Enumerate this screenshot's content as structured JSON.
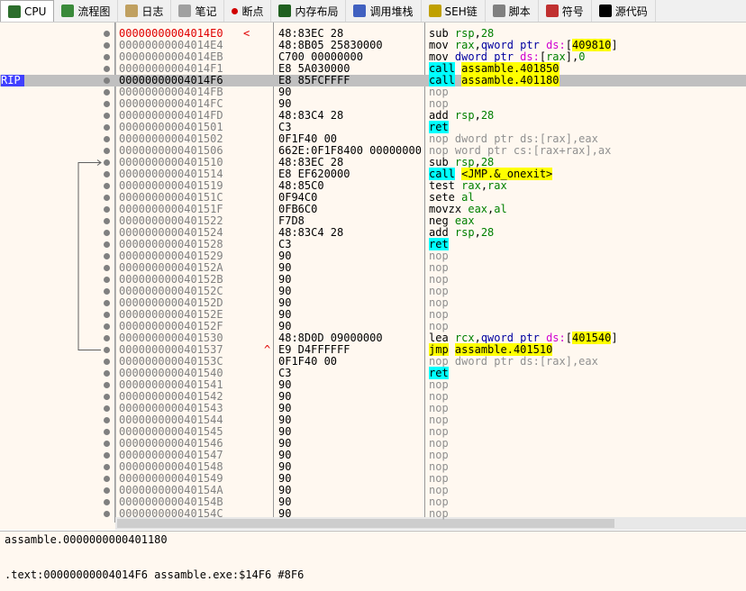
{
  "tabs": [
    {
      "label": "CPU",
      "icon": "cpu-icon",
      "color": "#2c6e2c",
      "active": true
    },
    {
      "label": "流程图",
      "icon": "tree-icon",
      "color": "#3a8a3a"
    },
    {
      "label": "日志",
      "icon": "log-icon",
      "color": "#c0a060"
    },
    {
      "label": "笔记",
      "icon": "notes-icon",
      "color": "#a0a0a0"
    },
    {
      "label": "断点",
      "icon": "breakpoint-icon",
      "color": "#d00000"
    },
    {
      "label": "内存布局",
      "icon": "memory-icon",
      "color": "#206020"
    },
    {
      "label": "调用堆栈",
      "icon": "callstack-icon",
      "color": "#4060c0"
    },
    {
      "label": "SEH链",
      "icon": "seh-icon",
      "color": "#c0a000"
    },
    {
      "label": "脚本",
      "icon": "script-icon",
      "color": "#808080"
    },
    {
      "label": "符号",
      "icon": "symbol-icon",
      "color": "#c03030"
    },
    {
      "label": "源代码",
      "icon": "source-icon",
      "color": "#000000"
    }
  ],
  "rip_label": "RIP",
  "rows": [
    {
      "a": "00000000004014E0",
      "m": "<",
      "b": "48:83EC 28",
      "d": [
        [
          "",
          "sub "
        ],
        [
          "r",
          "rsp"
        ],
        [
          "",
          ","
        ],
        [
          "n",
          "28"
        ]
      ],
      "cur": true
    },
    {
      "a": "00000000004014E4",
      "b": "48:8B05 25830000",
      "d": [
        [
          "",
          "mov "
        ],
        [
          "r",
          "rax"
        ],
        [
          "",
          ","
        ],
        [
          "k",
          "qword ptr "
        ],
        [
          "s",
          "ds:"
        ],
        [
          "",
          "["
        ],
        [
          "y",
          "409810"
        ],
        [
          "",
          "]"
        ]
      ]
    },
    {
      "a": "00000000004014EB",
      "b": "C700 00000000",
      "d": [
        [
          "",
          "mov "
        ],
        [
          "k",
          "dword ptr "
        ],
        [
          "s",
          "ds:"
        ],
        [
          "",
          "["
        ],
        [
          "r",
          "rax"
        ],
        [
          "",
          "],"
        ],
        [
          "n",
          "0"
        ]
      ]
    },
    {
      "a": "00000000004014F1",
      "b": "E8 5A030000",
      "d": [
        [
          "cy",
          "call"
        ],
        [
          "",
          " "
        ],
        [
          "y",
          "assamble.401850"
        ]
      ]
    },
    {
      "a": "00000000004014F6",
      "b": "E8 85FCFFFF",
      "d": [
        [
          "cy",
          "call"
        ],
        [
          "",
          " "
        ],
        [
          "y",
          "assamble.401180"
        ]
      ],
      "rip": true
    },
    {
      "a": "00000000004014FB",
      "b": "90",
      "d": [
        [
          "g",
          "nop"
        ]
      ]
    },
    {
      "a": "00000000004014FC",
      "b": "90",
      "d": [
        [
          "g",
          "nop"
        ]
      ]
    },
    {
      "a": "00000000004014FD",
      "b": "48:83C4 28",
      "d": [
        [
          "",
          "add "
        ],
        [
          "r",
          "rsp"
        ],
        [
          "",
          ","
        ],
        [
          "n",
          "28"
        ]
      ]
    },
    {
      "a": "0000000000401501",
      "b": "C3",
      "d": [
        [
          "cy",
          "ret"
        ]
      ]
    },
    {
      "a": "0000000000401502",
      "b": "0F1F40 00",
      "d": [
        [
          "g",
          "nop dword ptr ds:[rax],eax"
        ]
      ]
    },
    {
      "a": "0000000000401506",
      "b": "662E:0F1F8400 00000000",
      "d": [
        [
          "g",
          "nop word ptr cs:[rax+rax],ax"
        ]
      ]
    },
    {
      "a": "0000000000401510",
      "b": "48:83EC 28",
      "d": [
        [
          "",
          "sub "
        ],
        [
          "r",
          "rsp"
        ],
        [
          "",
          ","
        ],
        [
          "n",
          "28"
        ]
      ]
    },
    {
      "a": "0000000000401514",
      "b": "E8 EF620000",
      "d": [
        [
          "cy",
          "call"
        ],
        [
          "",
          " "
        ],
        [
          "y",
          "<JMP.&_onexit>"
        ]
      ]
    },
    {
      "a": "0000000000401519",
      "b": "48:85C0",
      "d": [
        [
          "",
          "test "
        ],
        [
          "r",
          "rax"
        ],
        [
          "",
          ","
        ],
        [
          "r",
          "rax"
        ]
      ]
    },
    {
      "a": "000000000040151C",
      "b": "0F94C0",
      "d": [
        [
          "",
          "sete "
        ],
        [
          "r",
          "al"
        ]
      ]
    },
    {
      "a": "000000000040151F",
      "b": "0FB6C0",
      "d": [
        [
          "",
          "movzx "
        ],
        [
          "r",
          "eax"
        ],
        [
          "",
          ","
        ],
        [
          "r",
          "al"
        ]
      ]
    },
    {
      "a": "0000000000401522",
      "b": "F7D8",
      "d": [
        [
          "",
          "neg "
        ],
        [
          "r",
          "eax"
        ]
      ]
    },
    {
      "a": "0000000000401524",
      "b": "48:83C4 28",
      "d": [
        [
          "",
          "add "
        ],
        [
          "r",
          "rsp"
        ],
        [
          "",
          ","
        ],
        [
          "n",
          "28"
        ]
      ]
    },
    {
      "a": "0000000000401528",
      "b": "C3",
      "d": [
        [
          "cy",
          "ret"
        ]
      ]
    },
    {
      "a": "0000000000401529",
      "b": "90",
      "d": [
        [
          "g",
          "nop"
        ]
      ]
    },
    {
      "a": "000000000040152A",
      "b": "90",
      "d": [
        [
          "g",
          "nop"
        ]
      ]
    },
    {
      "a": "000000000040152B",
      "b": "90",
      "d": [
        [
          "g",
          "nop"
        ]
      ]
    },
    {
      "a": "000000000040152C",
      "b": "90",
      "d": [
        [
          "g",
          "nop"
        ]
      ]
    },
    {
      "a": "000000000040152D",
      "b": "90",
      "d": [
        [
          "g",
          "nop"
        ]
      ]
    },
    {
      "a": "000000000040152E",
      "b": "90",
      "d": [
        [
          "g",
          "nop"
        ]
      ]
    },
    {
      "a": "000000000040152F",
      "b": "90",
      "d": [
        [
          "g",
          "nop"
        ]
      ]
    },
    {
      "a": "0000000000401530",
      "b": "48:8D0D 09000000",
      "d": [
        [
          "",
          "lea "
        ],
        [
          "r",
          "rcx"
        ],
        [
          "",
          ","
        ],
        [
          "k",
          "qword ptr "
        ],
        [
          "s",
          "ds:"
        ],
        [
          "",
          "["
        ],
        [
          "y",
          "401540"
        ],
        [
          "",
          "]"
        ]
      ]
    },
    {
      "a": "0000000000401537",
      "m": "^",
      "b": "E9 D4FFFFFF",
      "d": [
        [
          "y",
          "jmp"
        ],
        [
          "",
          " "
        ],
        [
          "y",
          "assamble.401510"
        ]
      ]
    },
    {
      "a": "000000000040153C",
      "b": "0F1F40 00",
      "d": [
        [
          "g",
          "nop dword ptr ds:[rax],eax"
        ]
      ]
    },
    {
      "a": "0000000000401540",
      "b": "C3",
      "d": [
        [
          "cy",
          "ret"
        ]
      ]
    },
    {
      "a": "0000000000401541",
      "b": "90",
      "d": [
        [
          "g",
          "nop"
        ]
      ]
    },
    {
      "a": "0000000000401542",
      "b": "90",
      "d": [
        [
          "g",
          "nop"
        ]
      ]
    },
    {
      "a": "0000000000401543",
      "b": "90",
      "d": [
        [
          "g",
          "nop"
        ]
      ]
    },
    {
      "a": "0000000000401544",
      "b": "90",
      "d": [
        [
          "g",
          "nop"
        ]
      ]
    },
    {
      "a": "0000000000401545",
      "b": "90",
      "d": [
        [
          "g",
          "nop"
        ]
      ]
    },
    {
      "a": "0000000000401546",
      "b": "90",
      "d": [
        [
          "g",
          "nop"
        ]
      ]
    },
    {
      "a": "0000000000401547",
      "b": "90",
      "d": [
        [
          "g",
          "nop"
        ]
      ]
    },
    {
      "a": "0000000000401548",
      "b": "90",
      "d": [
        [
          "g",
          "nop"
        ]
      ]
    },
    {
      "a": "0000000000401549",
      "b": "90",
      "d": [
        [
          "g",
          "nop"
        ]
      ]
    },
    {
      "a": "000000000040154A",
      "b": "90",
      "d": [
        [
          "g",
          "nop"
        ]
      ]
    },
    {
      "a": "000000000040154B",
      "b": "90",
      "d": [
        [
          "g",
          "nop"
        ]
      ]
    },
    {
      "a": "000000000040154C",
      "b": "90",
      "d": [
        [
          "g",
          "nop"
        ]
      ]
    }
  ],
  "info": {
    "line1": "assamble.0000000000401180",
    "line2": ".text:00000000004014F6 assamble.exe:$14F6 #8F6"
  }
}
